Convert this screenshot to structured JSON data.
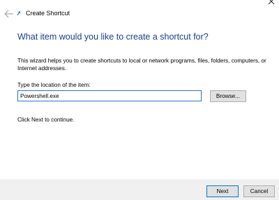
{
  "window": {
    "title": "Create Shortcut",
    "back_icon": "back-arrow-icon",
    "app_icon": "shortcut-icon",
    "close_icon": "close-icon"
  },
  "main": {
    "heading": "What item would you like to create a shortcut for?",
    "description": "This wizard helps you to create shortcuts to local or network programs, files, folders, computers, or Internet addresses.",
    "location_label": "Type the location of the item:",
    "location_value": "Powershell.exe",
    "browse_label": "Browse...",
    "hint": "Click Next to continue."
  },
  "footer": {
    "next_label": "Next",
    "cancel_label": "Cancel"
  },
  "colors": {
    "heading": "#1a3d8f",
    "focus_border": "#2b6fd1",
    "footer_bg": "#f0f0f0",
    "button_bg": "#e1e1e1",
    "default_button_border": "#0078d7"
  }
}
